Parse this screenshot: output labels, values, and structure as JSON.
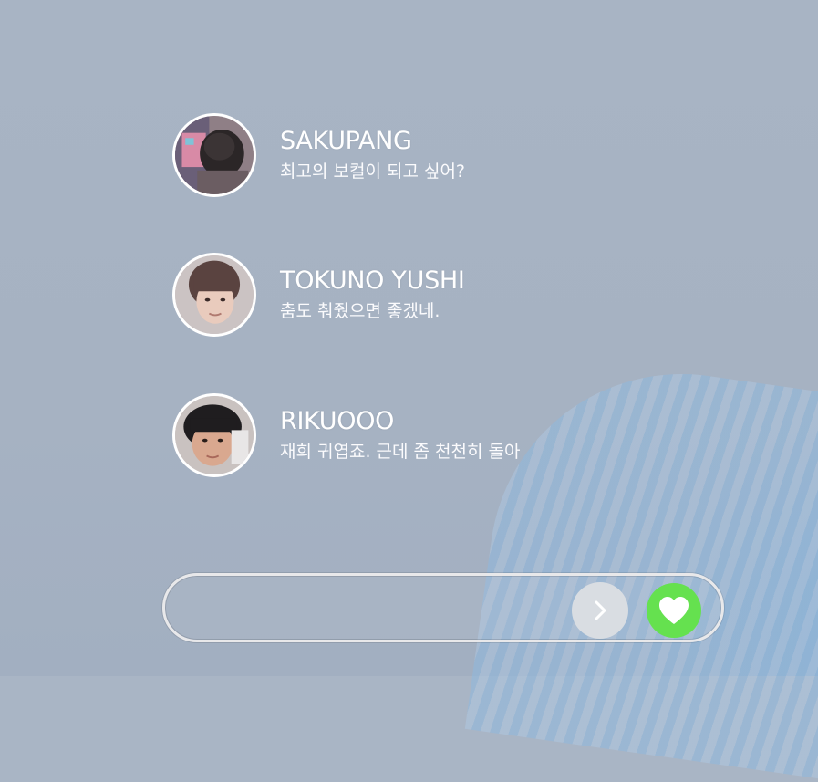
{
  "comments": [
    {
      "name": "SAKUPANG",
      "message": "최고의 보컬이 되고 싶어?",
      "avatar": "avatar-photo"
    },
    {
      "name": "TOKUNO YUSHI",
      "message": "춤도 춰줬으면 좋겠네.",
      "avatar": "avatar-photo"
    },
    {
      "name": "RIKUOOO",
      "message": "재희 귀엽죠. 근데 좀 천천히 돌아",
      "avatar": "avatar-photo"
    }
  ],
  "input": {
    "placeholder": "",
    "value": ""
  },
  "buttons": {
    "send_icon": "chevron-right-icon",
    "like_icon": "heart-icon"
  },
  "colors": {
    "like": "#65e14f",
    "send": "#d9dde2",
    "text": "#ffffff",
    "background": "#a9b5c5"
  }
}
